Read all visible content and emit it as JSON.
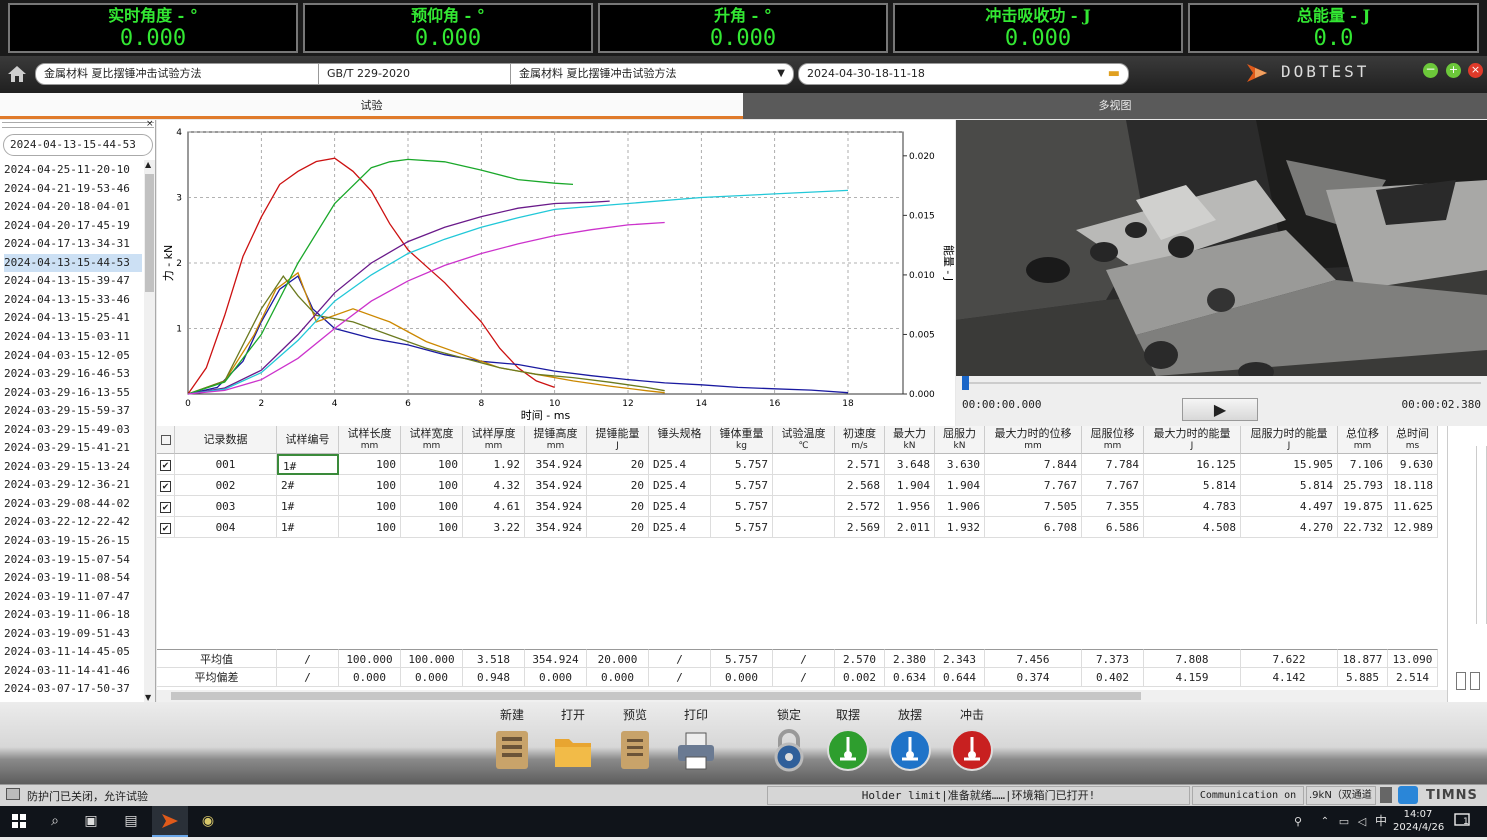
{
  "readouts": [
    {
      "label": "实时角度 - °",
      "value": "0.000"
    },
    {
      "label": "预仰角 - °",
      "value": "0.000"
    },
    {
      "label": "升角 - °",
      "value": "0.000"
    },
    {
      "label": "冲击吸收功 - J",
      "value": "0.000"
    },
    {
      "label": "总能量 - J",
      "value": "0.0"
    }
  ],
  "header": {
    "method_name": "金属材料 夏比摆锤冲击试验方法",
    "standard": "GB/T 229-2020",
    "method_select": "金属材料 夏比摆锤冲击试验方法",
    "record_id": "2024-04-30-18-11-18",
    "brand": "DOBTEST"
  },
  "tabs": [
    {
      "label": "试验"
    },
    {
      "label": "多视图"
    }
  ],
  "left_list": {
    "search_value": "2024-04-13-15-44-53",
    "items": [
      "2024-04-25-11-20-10",
      "2024-04-21-19-53-46",
      "2024-04-20-18-04-01",
      "2024-04-20-17-45-19",
      "2024-04-17-13-34-31",
      "2024-04-13-15-44-53",
      "2024-04-13-15-39-47",
      "2024-04-13-15-33-46",
      "2024-04-13-15-25-41",
      "2024-04-13-15-03-11",
      "2024-04-03-15-12-05",
      "2024-03-29-16-46-53",
      "2024-03-29-16-13-55",
      "2024-03-29-15-59-37",
      "2024-03-29-15-49-03",
      "2024-03-29-15-41-21",
      "2024-03-29-15-13-24",
      "2024-03-29-12-36-21",
      "2024-03-29-08-44-02",
      "2024-03-22-12-22-42",
      "2024-03-19-15-26-15",
      "2024-03-19-15-07-54",
      "2024-03-19-11-08-54",
      "2024-03-19-11-07-47",
      "2024-03-19-11-06-18",
      "2024-03-19-09-51-43",
      "2024-03-11-14-45-05",
      "2024-03-11-14-41-46",
      "2024-03-07-17-50-37"
    ],
    "selected_index": 5
  },
  "chart_data": {
    "type": "line",
    "xlabel": "时间 - ms",
    "ylabel": "力 - kN",
    "y2label": "能量 - J",
    "xlim": [
      0,
      20
    ],
    "ylim": [
      0,
      4
    ],
    "y2lim": [
      0,
      0.022
    ],
    "x_ticks": [
      "0",
      "2",
      "4",
      "6",
      "8",
      "10",
      "12",
      "14",
      "16",
      "18"
    ],
    "y_ticks": [
      "1",
      "2",
      "3",
      "4"
    ],
    "y2_ticks": [
      "0.000",
      "0.005",
      "0.010",
      "0.015",
      "0.020"
    ],
    "grid": true,
    "series": [
      {
        "axis": "force",
        "color": "#cc1111",
        "points": [
          [
            0,
            0
          ],
          [
            0.5,
            0.4
          ],
          [
            1,
            1.2
          ],
          [
            1.5,
            2.1
          ],
          [
            2,
            2.7
          ],
          [
            2.5,
            3.2
          ],
          [
            3,
            3.4
          ],
          [
            3.5,
            3.55
          ],
          [
            4,
            3.6
          ],
          [
            4.5,
            3.4
          ],
          [
            5,
            3.1
          ],
          [
            5.5,
            2.6
          ],
          [
            6,
            2.2
          ],
          [
            6.5,
            1.95
          ],
          [
            7,
            1.7
          ],
          [
            7.5,
            1.4
          ],
          [
            8,
            1.1
          ],
          [
            8.5,
            0.7
          ],
          [
            9,
            0.4
          ],
          [
            9.5,
            0.2
          ],
          [
            10,
            0.1
          ]
        ]
      },
      {
        "axis": "force",
        "color": "#1a1aa0",
        "points": [
          [
            0,
            0
          ],
          [
            0.8,
            0.1
          ],
          [
            1.5,
            0.5
          ],
          [
            2,
            1.1
          ],
          [
            2.5,
            1.6
          ],
          [
            3,
            1.8
          ],
          [
            3.4,
            1.3
          ],
          [
            4,
            1.0
          ],
          [
            5,
            0.85
          ],
          [
            6,
            0.75
          ],
          [
            7,
            0.6
          ],
          [
            8,
            0.5
          ],
          [
            9,
            0.45
          ],
          [
            10,
            0.35
          ],
          [
            11,
            0.28
          ],
          [
            12,
            0.22
          ],
          [
            13,
            0.17
          ],
          [
            14,
            0.14
          ],
          [
            15,
            0.1
          ],
          [
            16,
            0.08
          ],
          [
            17,
            0.06
          ],
          [
            18,
            0.02
          ]
        ]
      },
      {
        "axis": "force",
        "color": "#cc8800",
        "points": [
          [
            0,
            0
          ],
          [
            1,
            0.2
          ],
          [
            1.8,
            0.9
          ],
          [
            2.4,
            1.6
          ],
          [
            3,
            1.85
          ],
          [
            3.5,
            1.1
          ],
          [
            4.5,
            1.3
          ],
          [
            5.5,
            1.1
          ],
          [
            6.5,
            0.8
          ],
          [
            7.5,
            0.6
          ],
          [
            8.5,
            0.4
          ],
          [
            9.5,
            0.3
          ],
          [
            10.5,
            0.2
          ],
          [
            11.5,
            0.12
          ],
          [
            12.5,
            0.05
          ],
          [
            13,
            0.02
          ]
        ]
      },
      {
        "axis": "force",
        "color": "#6b7a1f",
        "points": [
          [
            0,
            0
          ],
          [
            1,
            0.2
          ],
          [
            2,
            1.3
          ],
          [
            2.6,
            1.8
          ],
          [
            3,
            1.5
          ],
          [
            3.5,
            1.2
          ],
          [
            4.5,
            1.1
          ],
          [
            5.5,
            0.9
          ],
          [
            6.5,
            0.7
          ],
          [
            7.5,
            0.55
          ],
          [
            8.5,
            0.4
          ],
          [
            9.5,
            0.3
          ],
          [
            10.5,
            0.25
          ],
          [
            11.5,
            0.18
          ],
          [
            12.5,
            0.1
          ],
          [
            13,
            0.05
          ]
        ]
      },
      {
        "axis": "energy",
        "color": "#1aa82a",
        "points": [
          [
            0,
            0
          ],
          [
            1,
            0.001
          ],
          [
            2,
            0.005
          ],
          [
            3,
            0.011
          ],
          [
            4,
            0.016
          ],
          [
            5,
            0.019
          ],
          [
            5.5,
            0.0195
          ],
          [
            6,
            0.0197
          ],
          [
            7,
            0.0195
          ],
          [
            8,
            0.0188
          ],
          [
            9,
            0.018
          ],
          [
            10,
            0.0177
          ],
          [
            10.5,
            0.0176
          ]
        ]
      },
      {
        "axis": "energy",
        "color": "#6a1a8a",
        "points": [
          [
            0,
            0
          ],
          [
            1,
            0.0005
          ],
          [
            2,
            0.002
          ],
          [
            3,
            0.005
          ],
          [
            4,
            0.0085
          ],
          [
            5,
            0.011
          ],
          [
            6,
            0.0128
          ],
          [
            7,
            0.014
          ],
          [
            8,
            0.0149
          ],
          [
            9,
            0.0156
          ],
          [
            10,
            0.016
          ],
          [
            11,
            0.0161
          ],
          [
            11.5,
            0.0162
          ]
        ]
      },
      {
        "axis": "energy",
        "color": "#22c8d8",
        "points": [
          [
            0,
            0
          ],
          [
            1,
            0.0004
          ],
          [
            2,
            0.0018
          ],
          [
            3,
            0.0045
          ],
          [
            4,
            0.0078
          ],
          [
            5,
            0.01
          ],
          [
            6,
            0.0118
          ],
          [
            7,
            0.013
          ],
          [
            8,
            0.014
          ],
          [
            9,
            0.0148
          ],
          [
            10,
            0.0155
          ],
          [
            12,
            0.016
          ],
          [
            14,
            0.0165
          ],
          [
            16,
            0.0168
          ],
          [
            18,
            0.0171
          ]
        ]
      },
      {
        "axis": "energy",
        "color": "#cc33cc",
        "points": [
          [
            0,
            0
          ],
          [
            1,
            0.0003
          ],
          [
            2,
            0.0012
          ],
          [
            3,
            0.003
          ],
          [
            4,
            0.0055
          ],
          [
            5,
            0.0078
          ],
          [
            6,
            0.0095
          ],
          [
            7,
            0.0108
          ],
          [
            8,
            0.0118
          ],
          [
            9,
            0.0126
          ],
          [
            10,
            0.0133
          ],
          [
            11,
            0.0138
          ],
          [
            12,
            0.0142
          ],
          [
            13,
            0.0144
          ]
        ]
      }
    ]
  },
  "video": {
    "time_start": "00:00:00.000",
    "time_end": "00:00:02.380"
  },
  "table": {
    "headers": [
      {
        "label": "记录数据",
        "unit": ""
      },
      {
        "label": "试样编号",
        "unit": ""
      },
      {
        "label": "试样长度",
        "unit": "mm"
      },
      {
        "label": "试样宽度",
        "unit": "mm"
      },
      {
        "label": "试样厚度",
        "unit": "mm"
      },
      {
        "label": "提锤高度",
        "unit": "mm"
      },
      {
        "label": "提锤能量",
        "unit": "J"
      },
      {
        "label": "锤头规格",
        "unit": ""
      },
      {
        "label": "锤体重量",
        "unit": "kg"
      },
      {
        "label": "试验温度",
        "unit": "℃"
      },
      {
        "label": "初速度",
        "unit": "m/s"
      },
      {
        "label": "最大力",
        "unit": "kN"
      },
      {
        "label": "屈服力",
        "unit": "kN"
      },
      {
        "label": "最大力时的位移",
        "unit": "mm"
      },
      {
        "label": "屈服位移",
        "unit": "mm"
      },
      {
        "label": "最大力时的能量",
        "unit": "J"
      },
      {
        "label": "屈服力时的能量",
        "unit": "J"
      },
      {
        "label": "总位移",
        "unit": "mm"
      },
      {
        "label": "总时间",
        "unit": "ms"
      }
    ],
    "rows": [
      [
        "001",
        "1#",
        "100",
        "100",
        "1.92",
        "354.924",
        "20",
        "D25.4",
        "5.757",
        "",
        "2.571",
        "3.648",
        "3.630",
        "7.844",
        "7.784",
        "16.125",
        "15.905",
        "7.106",
        "9.630"
      ],
      [
        "002",
        "2#",
        "100",
        "100",
        "4.32",
        "354.924",
        "20",
        "D25.4",
        "5.757",
        "",
        "2.568",
        "1.904",
        "1.904",
        "7.767",
        "7.767",
        "5.814",
        "5.814",
        "25.793",
        "18.118"
      ],
      [
        "003",
        "1#",
        "100",
        "100",
        "4.61",
        "354.924",
        "20",
        "D25.4",
        "5.757",
        "",
        "2.572",
        "1.956",
        "1.906",
        "7.505",
        "7.355",
        "4.783",
        "4.497",
        "19.875",
        "11.625"
      ],
      [
        "004",
        "1#",
        "100",
        "100",
        "3.22",
        "354.924",
        "20",
        "D25.4",
        "5.757",
        "",
        "2.569",
        "2.011",
        "1.932",
        "6.708",
        "6.586",
        "4.508",
        "4.270",
        "22.732",
        "12.989"
      ]
    ],
    "summary": [
      [
        "平均值",
        "/",
        "100.000",
        "100.000",
        "3.518",
        "354.924",
        "20.000",
        "/",
        "5.757",
        "/",
        "2.570",
        "2.380",
        "2.343",
        "7.456",
        "7.373",
        "7.808",
        "7.622",
        "18.877",
        "13.090"
      ],
      [
        "平均偏差",
        "/",
        "0.000",
        "0.000",
        "0.948",
        "0.000",
        "0.000",
        "/",
        "0.000",
        "/",
        "0.002",
        "0.634",
        "0.644",
        "0.374",
        "0.402",
        "4.159",
        "4.142",
        "5.885",
        "2.514"
      ]
    ]
  },
  "toolbar": [
    {
      "label": "新建",
      "icon": "new-file-icon"
    },
    {
      "label": "打开",
      "icon": "open-folder-icon"
    },
    {
      "label": "预览",
      "icon": "preview-icon"
    },
    {
      "label": "打印",
      "icon": "printer-icon"
    },
    {
      "label": "锁定",
      "icon": "lock-icon"
    },
    {
      "label": "取摆",
      "icon": "take-pendulum-icon",
      "color": "#2e9e2e"
    },
    {
      "label": "放摆",
      "icon": "release-pendulum-icon",
      "color": "#1f73c8"
    },
    {
      "label": "冲击",
      "icon": "impact-icon",
      "color": "#c82020"
    }
  ],
  "status": {
    "left": "防护门已关闭，允许试验",
    "middle": "Holder limit|准备就绪……|环境箱门已打开!",
    "comm": "Communication on",
    "range": ".9kN（双通道"
  },
  "taskbar": {
    "time": "14:07",
    "date": "2024/4/26",
    "ime": "中",
    "notif": "1"
  }
}
